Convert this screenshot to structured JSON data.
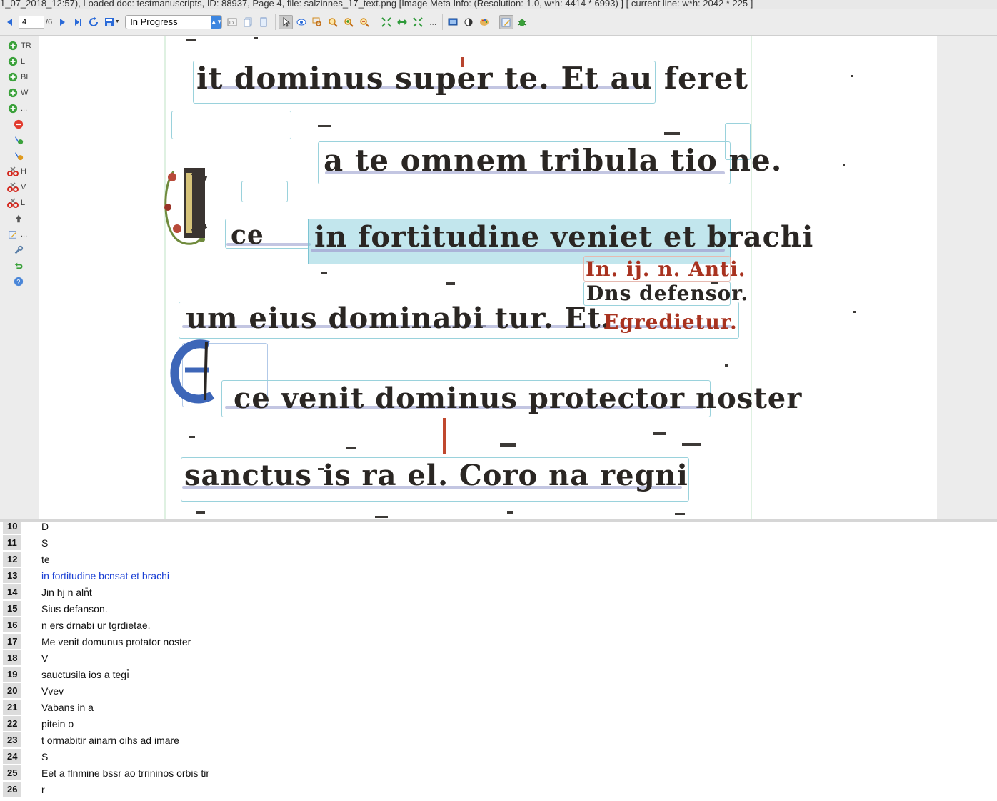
{
  "titlebar": {
    "text": "1_07_2018_12:57), Loaded doc: testmanuscripts, ID: 88937, Page 4, file: salzinnes_17_text.png [Image Meta Info: (Resolution:-1.0, w*h: 4414 * 6993) ] [ current line: w*h: 2042 * 225 ]"
  },
  "toolbar": {
    "page_value": "4",
    "page_total": "/6",
    "status_value": "In Progress",
    "overflow_dots": "..."
  },
  "sidebar": {
    "items": [
      {
        "label": "TR",
        "icon": "add-circle-icon"
      },
      {
        "label": "L",
        "icon": "add-circle-icon"
      },
      {
        "label": "BL",
        "icon": "add-circle-icon"
      },
      {
        "label": "W",
        "icon": "add-circle-icon"
      },
      {
        "label": "...",
        "icon": "add-circle-icon"
      },
      {
        "label": "",
        "icon": "remove-circle-icon"
      },
      {
        "label": "",
        "icon": "add-point-icon"
      },
      {
        "label": "",
        "icon": "remove-point-icon"
      },
      {
        "label": "H",
        "icon": "split-scissors-icon"
      },
      {
        "label": "V",
        "icon": "split-scissors-icon"
      },
      {
        "label": "L",
        "icon": "split-scissors-icon"
      },
      {
        "label": "",
        "icon": "merge-icon"
      },
      {
        "label": "...",
        "icon": "edit-icon"
      },
      {
        "label": "",
        "icon": "wrench-icon"
      },
      {
        "label": "",
        "icon": "undo-icon"
      },
      {
        "label": "",
        "icon": "help-icon"
      }
    ]
  },
  "manuscript": {
    "lines": [
      {
        "text": "it dominus super te. Et au  feret",
        "red": false
      },
      {
        "text": "a te omnem tribula tio  ne.",
        "red": false
      },
      {
        "text": "ce",
        "red": false
      },
      {
        "text": "in fortitudine veniet et brachi",
        "red": false
      },
      {
        "text": "In. ij. n. Anti.",
        "red": true
      },
      {
        "text": "Dns defensor.",
        "red": false
      },
      {
        "text": "um eius dominabi  tur. Et.",
        "red": false
      },
      {
        "text": "Egredietur.",
        "red": true
      },
      {
        "text": "ce venit dominus protector noster",
        "red": false
      },
      {
        "text": "sanctus is  ra  el. Coro  na regni",
        "red": false
      }
    ]
  },
  "textlines": [
    {
      "num": "10",
      "text": "D",
      "active": false
    },
    {
      "num": "11",
      "text": "S",
      "active": false
    },
    {
      "num": "12",
      "text": "te",
      "active": false
    },
    {
      "num": "13",
      "text": "in fortitudine bcnsat et brachi",
      "active": true
    },
    {
      "num": "14",
      "text": "Jin hj n aln̄t",
      "active": false
    },
    {
      "num": "15",
      "text": "Sius defanson.",
      "active": false
    },
    {
      "num": "16",
      "text": "n ers drnabi ur tgrdietae.",
      "active": false
    },
    {
      "num": "17",
      "text": "Me venit domunus protator noster",
      "active": false
    },
    {
      "num": "18",
      "text": "V",
      "active": false
    },
    {
      "num": "19",
      "text": "sauctusila ios a tegı̊",
      "active": false
    },
    {
      "num": "20",
      "text": "Vvev",
      "active": false
    },
    {
      "num": "21",
      "text": "Vabans in a",
      "active": false
    },
    {
      "num": "22",
      "text": "pitein o",
      "active": false
    },
    {
      "num": "23",
      "text": "t ormabitir ainarn oihs ad imare",
      "active": false
    },
    {
      "num": "24",
      "text": "S",
      "active": false
    },
    {
      "num": "25",
      "text": "Eet a flnmine bssr ao trrininos orbis tir",
      "active": false
    },
    {
      "num": "26",
      "text": "r",
      "active": false
    }
  ],
  "colors": {
    "accent_blue": "#1a3fd4",
    "manuscript_ink": "#2a2623",
    "rubric_red": "#a8321f",
    "selection": "#78c8d7"
  }
}
